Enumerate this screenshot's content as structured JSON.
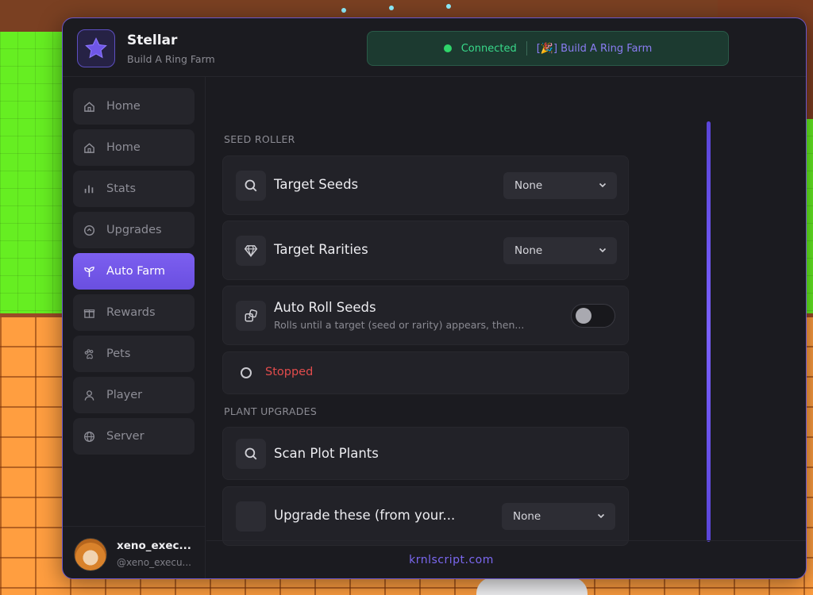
{
  "app": {
    "title": "Stellar",
    "subtitle": "Build A Ring Farm"
  },
  "status": {
    "state": "Connected",
    "game": "[🎉] Build A Ring Farm",
    "color": "#2fd56a"
  },
  "sidebar": {
    "items": [
      {
        "label": "Home",
        "icon": "home-icon",
        "active": false
      },
      {
        "label": "Home",
        "icon": "home-icon",
        "active": false
      },
      {
        "label": "Stats",
        "icon": "bar-chart-icon",
        "active": false
      },
      {
        "label": "Upgrades",
        "icon": "circle-arrow-up-icon",
        "active": false
      },
      {
        "label": "Auto Farm",
        "icon": "sprout-icon",
        "active": true
      },
      {
        "label": "Rewards",
        "icon": "gift-icon",
        "active": false
      },
      {
        "label": "Pets",
        "icon": "paw-icon",
        "active": false
      },
      {
        "label": "Player",
        "icon": "user-icon",
        "active": false
      },
      {
        "label": "Server",
        "icon": "globe-icon",
        "active": false
      }
    ],
    "profile": {
      "name": "xeno_exec...",
      "handle": "@xeno_execu..."
    }
  },
  "main": {
    "seed_roller": {
      "section_label": "SEED ROLLER",
      "target_seeds": {
        "label": "Target Seeds",
        "value": "None",
        "icon": "search-icon"
      },
      "target_rarities": {
        "label": "Target Rarities",
        "value": "None",
        "icon": "gem-icon"
      },
      "auto_roll": {
        "label": "Auto Roll Seeds",
        "description": "Rolls until a target (seed or rarity) appears, then...",
        "enabled": false,
        "icon": "dice-icon"
      },
      "status": {
        "text": "Stopped",
        "color": "#e24c4c"
      }
    },
    "plant_upgrades": {
      "section_label": "PLANT UPGRADES",
      "scan": {
        "label": "Scan Plot Plants",
        "icon": "search-icon"
      },
      "upgrade_these": {
        "label": "Upgrade these (from your...",
        "value": "None"
      }
    }
  },
  "footer": {
    "link": "krnlscript.com"
  },
  "colors": {
    "accent": "#7c5ff0",
    "window_bg": "#1b1b20",
    "card_bg": "#222228"
  }
}
